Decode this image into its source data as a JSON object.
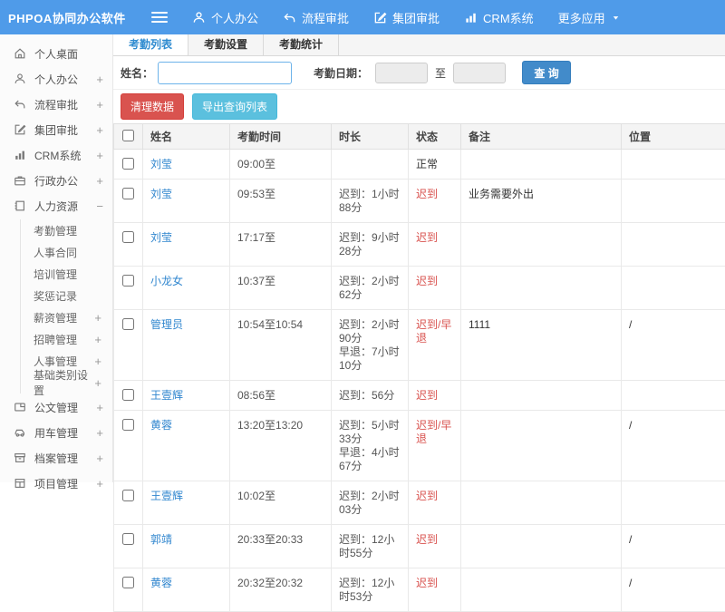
{
  "brand": "PHPOA协同办公软件",
  "topnav": {
    "items": [
      {
        "label": "个人办公",
        "icon": "user-icon"
      },
      {
        "label": "流程审批",
        "icon": "reply-arrow-icon"
      },
      {
        "label": "集团审批",
        "icon": "edit-icon"
      },
      {
        "label": "CRM系统",
        "icon": "bar-chart-icon"
      },
      {
        "label": "更多应用",
        "icon": "caret-down-icon"
      }
    ]
  },
  "sidebar": {
    "items": [
      {
        "label": "个人桌面",
        "expand": ""
      },
      {
        "label": "个人办公",
        "expand": "+"
      },
      {
        "label": "流程审批",
        "expand": "+"
      },
      {
        "label": "集团审批",
        "expand": "+"
      },
      {
        "label": "CRM系统",
        "expand": "+"
      },
      {
        "label": "行政办公",
        "expand": "+"
      },
      {
        "label": "人力资源",
        "expand": "−"
      }
    ],
    "hr_children": [
      {
        "label": "考勤管理",
        "expand": ""
      },
      {
        "label": "人事合同",
        "expand": ""
      },
      {
        "label": "培训管理",
        "expand": ""
      },
      {
        "label": "奖惩记录",
        "expand": ""
      },
      {
        "label": "薪资管理",
        "expand": "+"
      },
      {
        "label": "招聘管理",
        "expand": "+"
      },
      {
        "label": "人事管理",
        "expand": "+"
      },
      {
        "label": "基础类别设置",
        "expand": "+"
      }
    ],
    "items_after": [
      {
        "label": "公文管理",
        "expand": "+"
      },
      {
        "label": "用车管理",
        "expand": "+"
      },
      {
        "label": "档案管理",
        "expand": "+"
      },
      {
        "label": "项目管理",
        "expand": "+"
      }
    ]
  },
  "tabs": [
    {
      "label": "考勤列表",
      "active": true
    },
    {
      "label": "考勤设置",
      "active": false
    },
    {
      "label": "考勤统计",
      "active": false
    }
  ],
  "filter": {
    "name_label": "姓名：",
    "name_value": "",
    "date_label": "考勤日期：",
    "date_from_value": "",
    "to_label": "至",
    "date_to_value": "",
    "search_button": "查 询"
  },
  "actions": {
    "clear_button": "清理数据",
    "export_button": "导出查询列表"
  },
  "table": {
    "headers": [
      "姓名",
      "考勤时间",
      "时长",
      "状态",
      "备注",
      "位置"
    ],
    "rows": [
      {
        "name": "刘莹",
        "time": "09:00至",
        "duration": "",
        "duration2": "",
        "status": "正常",
        "status_type": "normal",
        "note": "",
        "location": ""
      },
      {
        "name": "刘莹",
        "time": "09:53至",
        "duration": "迟到：1小时88分",
        "duration2": "",
        "status": "迟到",
        "status_type": "late",
        "note": "业务需要外出",
        "location": ""
      },
      {
        "name": "刘莹",
        "time": "17:17至",
        "duration": "迟到：9小时28分",
        "duration2": "",
        "status": "迟到",
        "status_type": "late",
        "note": "",
        "location": ""
      },
      {
        "name": "小龙女",
        "time": "10:37至",
        "duration": "迟到：2小时62分",
        "duration2": "",
        "status": "迟到",
        "status_type": "late",
        "note": "",
        "location": ""
      },
      {
        "name": "管理员",
        "time": "10:54至10:54",
        "duration": "迟到：2小时90分",
        "duration2": "早退：7小时10分",
        "status": "迟到/早退",
        "status_type": "late",
        "note": "1111",
        "location": "/"
      },
      {
        "name": "王壹辉",
        "time": "08:56至",
        "duration": "迟到：56分",
        "duration2": "",
        "status": "迟到",
        "status_type": "late",
        "note": "",
        "location": ""
      },
      {
        "name": "黄蓉",
        "time": "13:20至13:20",
        "duration": "迟到：5小时33分",
        "duration2": "早退：4小时67分",
        "status": "迟到/早退",
        "status_type": "late",
        "note": "",
        "location": "/"
      },
      {
        "name": "王壹辉",
        "time": "10:02至",
        "duration": "迟到：2小时03分",
        "duration2": "",
        "status": "迟到",
        "status_type": "late",
        "note": "",
        "location": ""
      },
      {
        "name": "郭靖",
        "time": "20:33至20:33",
        "duration": "迟到：12小时55分",
        "duration2": "",
        "status": "迟到",
        "status_type": "late",
        "note": "",
        "location": "/"
      },
      {
        "name": "黄蓉",
        "time": "20:32至20:32",
        "duration": "迟到：12小时53分",
        "duration2": "",
        "status": "迟到",
        "status_type": "late",
        "note": "",
        "location": "/"
      }
    ]
  },
  "colors": {
    "header_blue": "#4F9BE9",
    "link_blue": "#3287CF",
    "search_blue": "#428BCA",
    "danger_red": "#D9534F",
    "info_cyan": "#5BC0DE",
    "status_late_red": "#D9534F"
  }
}
